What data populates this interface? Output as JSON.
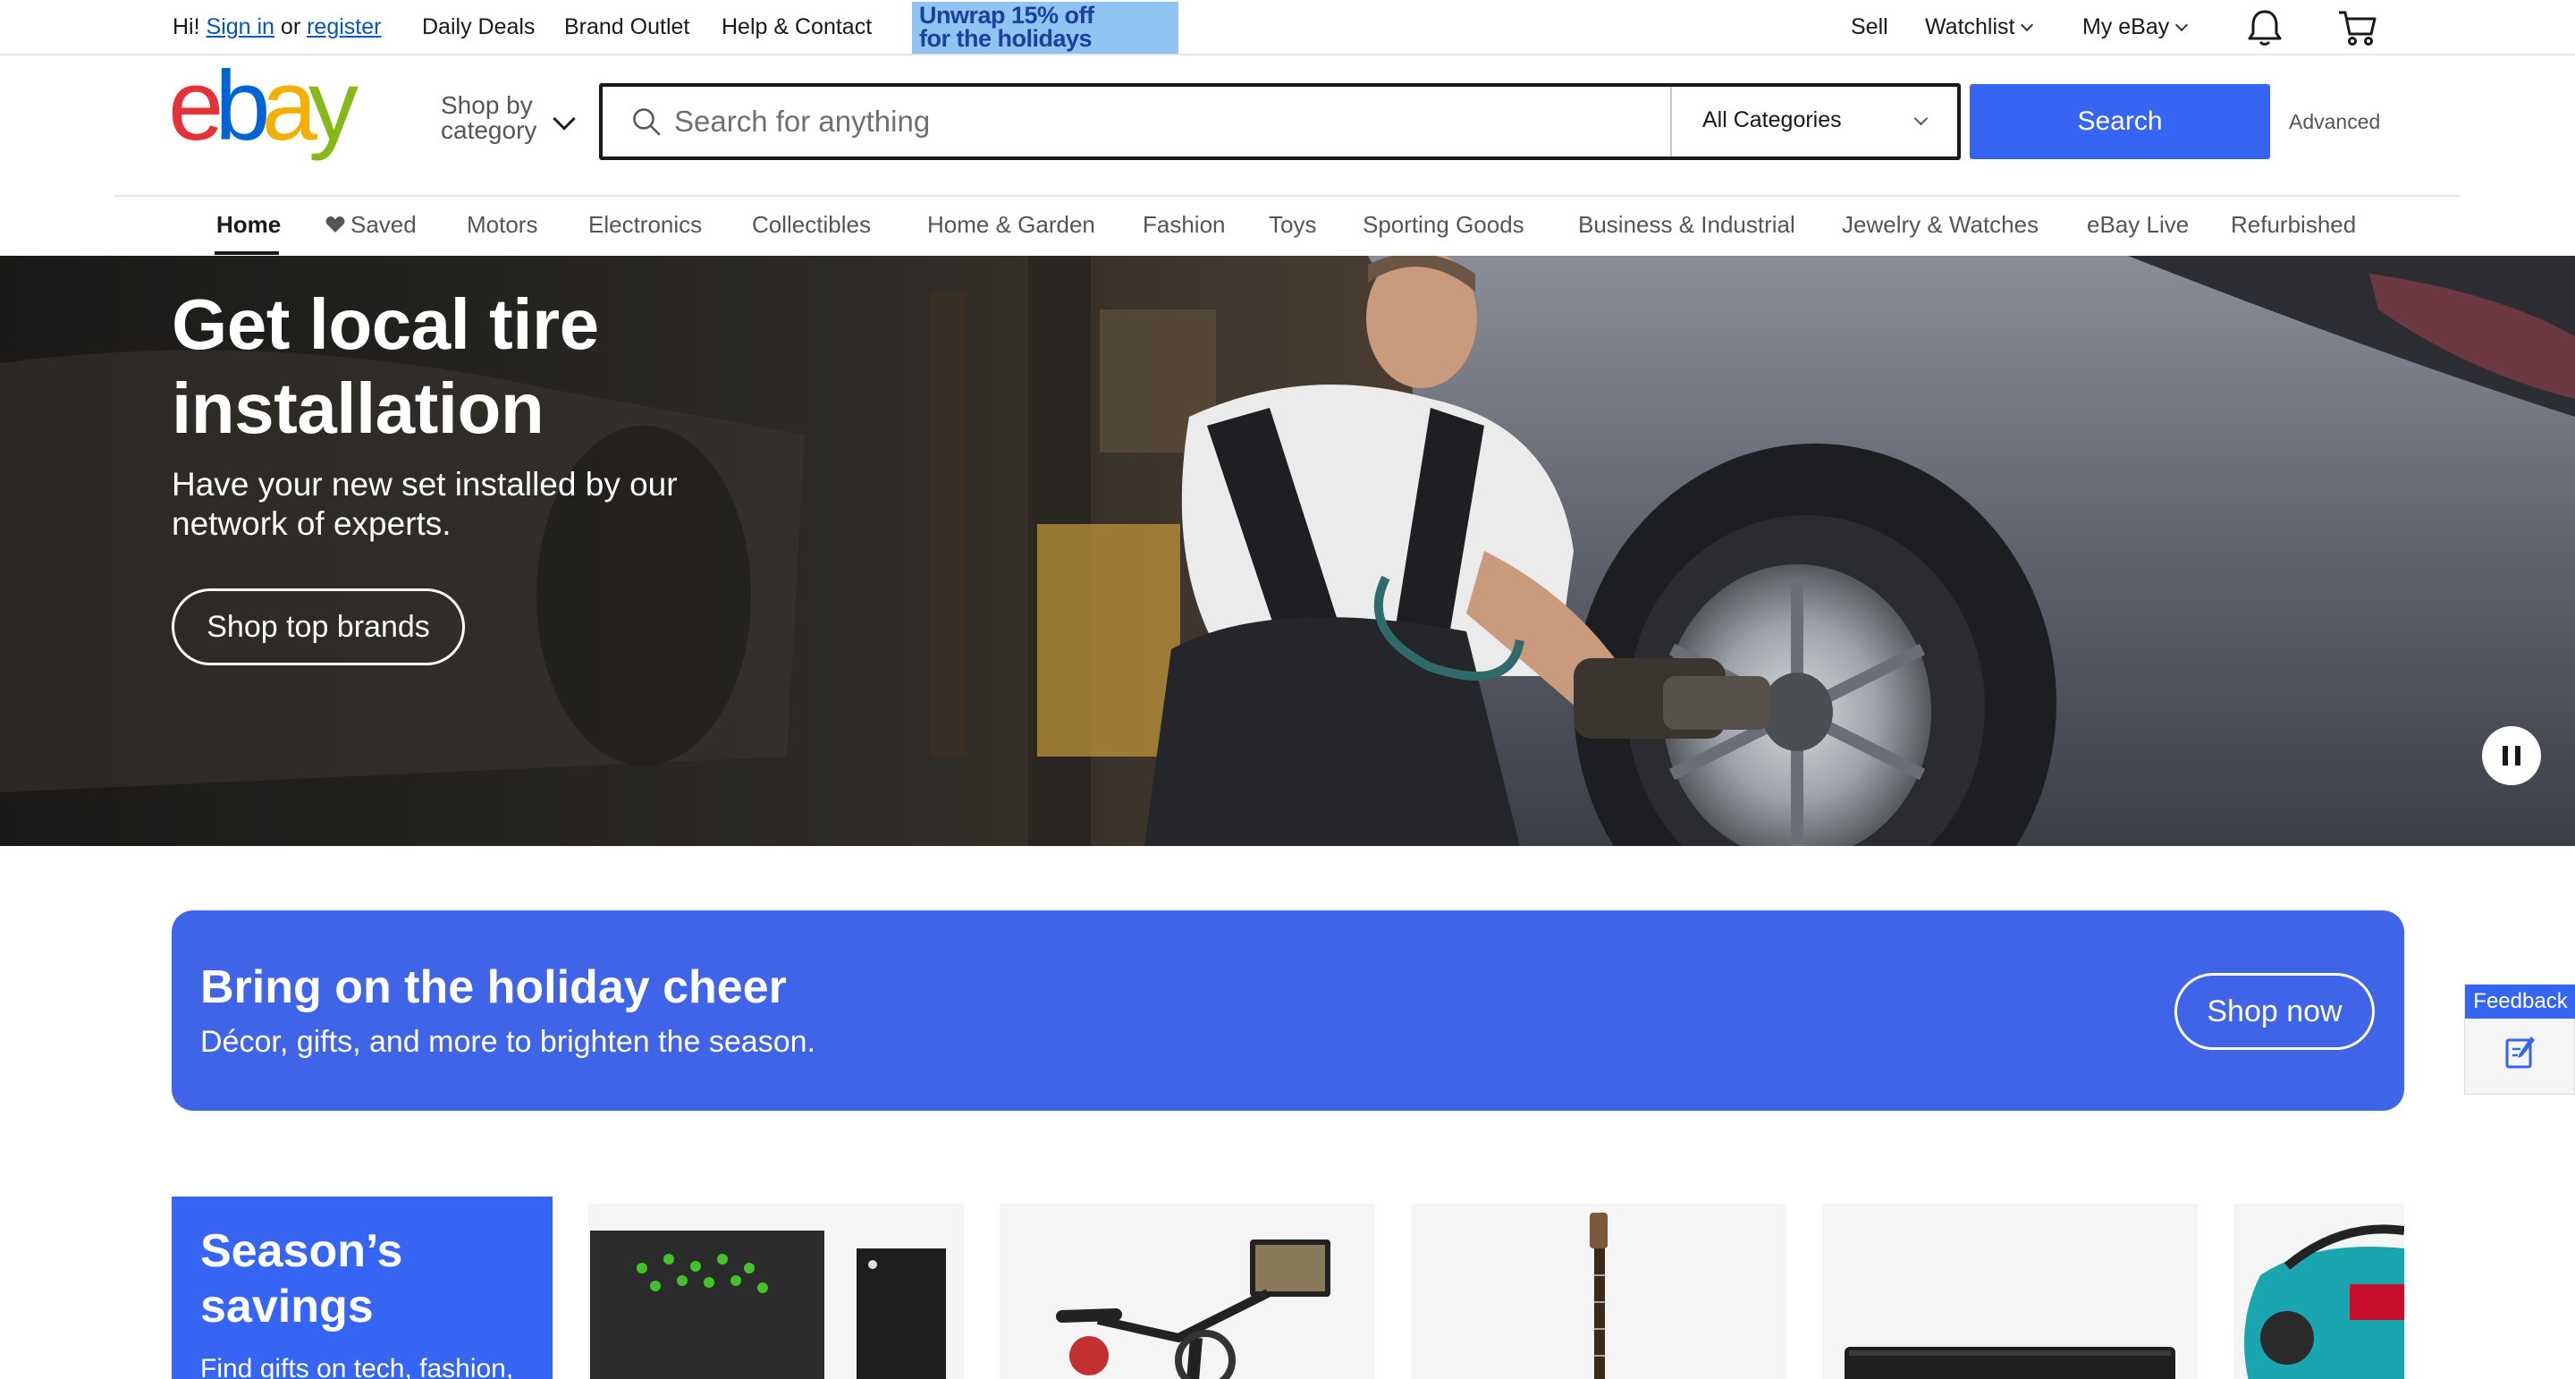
{
  "topbar": {
    "greeting": "Hi!",
    "sign_in": "Sign in",
    "or": "or",
    "register": "register",
    "daily_deals": "Daily Deals",
    "brand_outlet": "Brand Outlet",
    "help_contact": "Help & Contact",
    "promo_line1": "Unwrap 15% off",
    "promo_line2": "for the holidays",
    "sell": "Sell",
    "watchlist": "Watchlist",
    "my_ebay": "My eBay",
    "icons": [
      "bell-icon",
      "cart-icon"
    ]
  },
  "header": {
    "logo_letters": [
      "e",
      "b",
      "a",
      "y"
    ],
    "logo_colors": [
      "#e53238",
      "#0064d2",
      "#f5af02",
      "#86b817"
    ],
    "shop_by_line1": "Shop by",
    "shop_by_line2": "category",
    "search_placeholder": "Search for anything",
    "search_value": "",
    "category_selected": "All Categories",
    "search_button": "Search",
    "advanced": "Advanced",
    "accent_color": "#3665f3"
  },
  "nav": {
    "items": [
      {
        "label": "Home",
        "active": true
      },
      {
        "label": "Saved",
        "active": false,
        "icon": "heart-icon"
      },
      {
        "label": "Motors",
        "active": false
      },
      {
        "label": "Electronics",
        "active": false
      },
      {
        "label": "Collectibles",
        "active": false
      },
      {
        "label": "Home & Garden",
        "active": false
      },
      {
        "label": "Fashion",
        "active": false
      },
      {
        "label": "Toys",
        "active": false
      },
      {
        "label": "Sporting Goods",
        "active": false
      },
      {
        "label": "Business & Industrial",
        "active": false
      },
      {
        "label": "Jewelry & Watches",
        "active": false
      },
      {
        "label": "eBay Live",
        "active": false
      },
      {
        "label": "Refurbished",
        "active": false
      }
    ]
  },
  "hero": {
    "title": "Get local tire installation",
    "subtitle": "Have your new set installed by our network of experts.",
    "button": "Shop top brands",
    "pause_icon": "pause-icon"
  },
  "holiday_banner": {
    "title": "Bring on the holiday cheer",
    "subtitle": "Décor, gifts, and more to brighten the season.",
    "button": "Shop now",
    "color": "#4064e8"
  },
  "feedback": {
    "label": "Feedback",
    "icon": "edit-note-icon"
  },
  "season": {
    "title": "Season’s savings",
    "subtitle": "Find gifts on tech, fashion,",
    "products": [
      "xbox-console-image",
      "exercise-bike-image",
      "electric-guitar-image",
      "soundbar-image",
      "power-tool-bag-image"
    ]
  }
}
